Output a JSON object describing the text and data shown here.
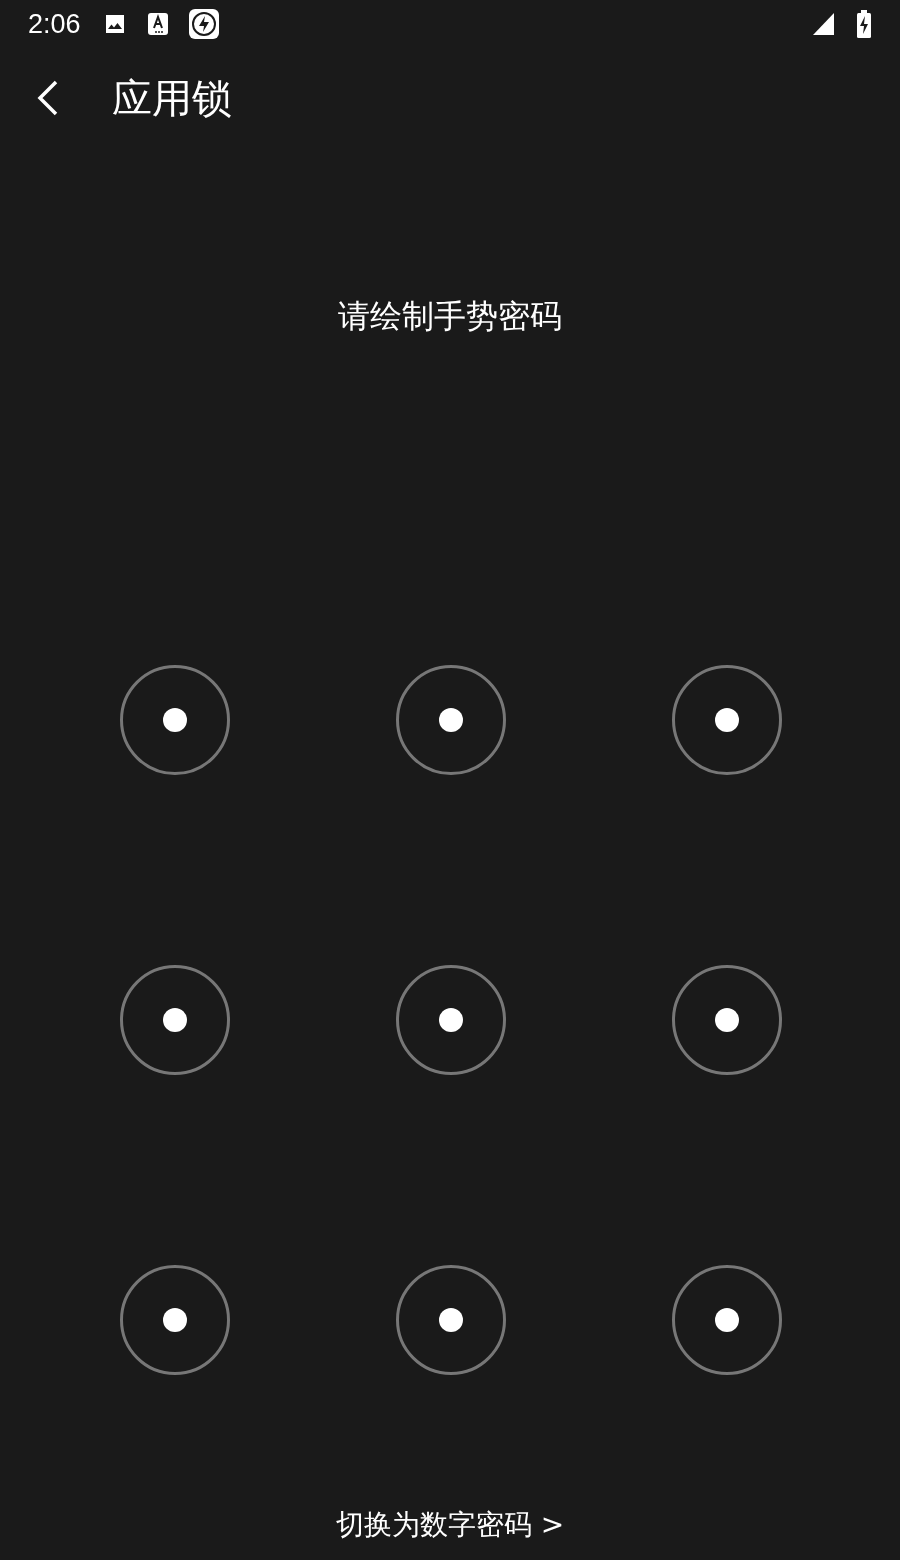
{
  "status_bar": {
    "time": "2:06"
  },
  "toolbar": {
    "title": "应用锁"
  },
  "prompt": "请绘制手势密码",
  "pattern": {
    "nodes": [
      {
        "selected": false
      },
      {
        "selected": false
      },
      {
        "selected": false
      },
      {
        "selected": false
      },
      {
        "selected": false
      },
      {
        "selected": false
      },
      {
        "selected": false
      },
      {
        "selected": false
      },
      {
        "selected": false
      }
    ]
  },
  "switch_link": "切换为数字密码 >"
}
